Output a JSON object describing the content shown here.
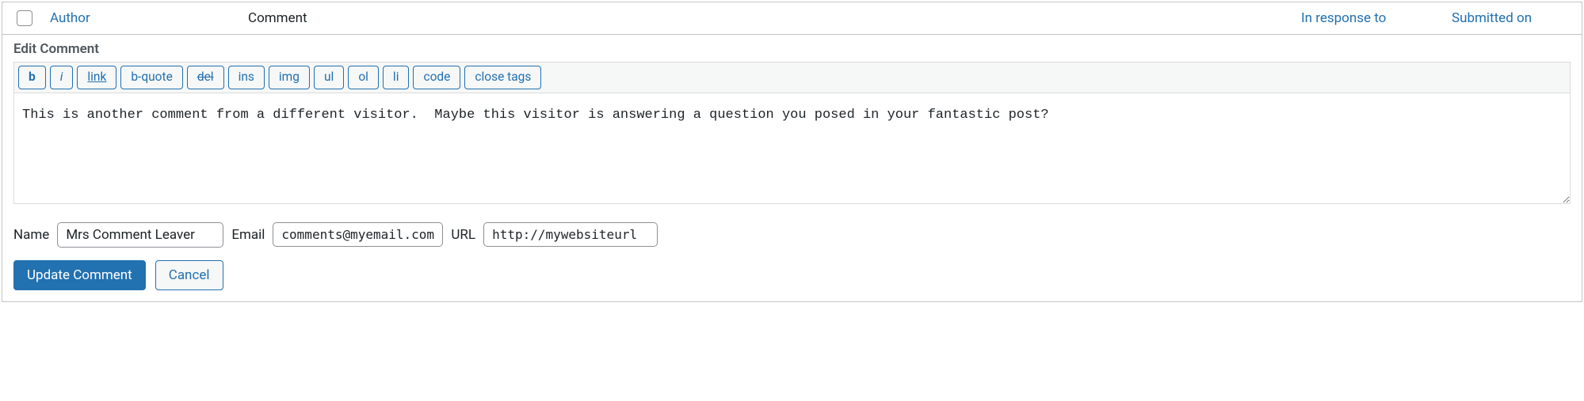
{
  "columns": {
    "author": "Author",
    "comment": "Comment",
    "in_response_to": "In response to",
    "submitted_on": "Submitted on"
  },
  "edit": {
    "title": "Edit Comment",
    "toolbar": {
      "b": "b",
      "i": "i",
      "link": "link",
      "bquote": "b-quote",
      "del": "del",
      "ins": "ins",
      "img": "img",
      "ul": "ul",
      "ol": "ol",
      "li": "li",
      "code": "code",
      "close_tags": "close tags"
    },
    "content": "This is another comment from a different visitor.  Maybe this visitor is answering a question you posed in your fantastic post?",
    "fields": {
      "name_label": "Name",
      "name_value": "Mrs Comment Leaver",
      "email_label": "Email",
      "email_value": "comments@myemail.com",
      "url_label": "URL",
      "url_value": "http://mywebsiteurl"
    },
    "actions": {
      "update": "Update Comment",
      "cancel": "Cancel"
    }
  }
}
